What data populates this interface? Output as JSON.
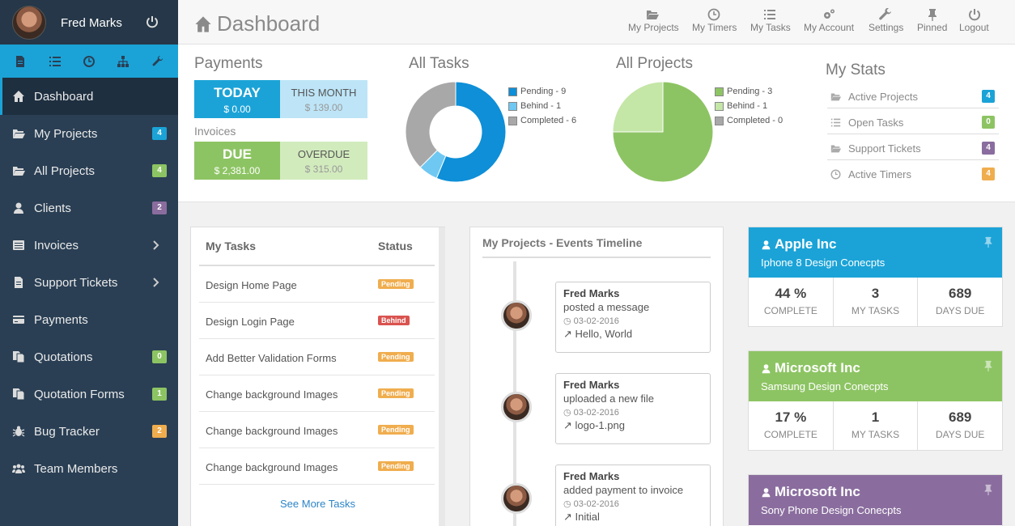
{
  "user": {
    "name": "Fred Marks"
  },
  "sidebar": {
    "items": [
      {
        "label": "Dashboard"
      },
      {
        "label": "My Projects",
        "badge": "4"
      },
      {
        "label": "All Projects",
        "badge": "4"
      },
      {
        "label": "Clients",
        "badge": "2"
      },
      {
        "label": "Invoices"
      },
      {
        "label": "Support Tickets"
      },
      {
        "label": "Payments"
      },
      {
        "label": "Quotations",
        "badge": "0"
      },
      {
        "label": "Quotation Forms",
        "badge": "1"
      },
      {
        "label": "Bug Tracker",
        "badge": "2"
      },
      {
        "label": "Team Members"
      }
    ]
  },
  "header": {
    "title": "Dashboard",
    "nav": [
      "My Projects",
      "My Timers",
      "My Tasks",
      "My Account",
      "Settings",
      "Pinned",
      "Logout"
    ]
  },
  "payments": {
    "title": "Payments",
    "today_label": "TODAY",
    "today_value": "$ 0.00",
    "month_label": "THIS MONTH",
    "month_value": "$ 139.00",
    "invoices_title": "Invoices",
    "due_label": "DUE",
    "due_value": "$ 2,381.00",
    "overdue_label": "OVERDUE",
    "overdue_value": "$ 315.00"
  },
  "all_tasks": {
    "title": "All Tasks",
    "legend": [
      "Pending - 9",
      "Behind - 1",
      "Completed - 6"
    ]
  },
  "all_projects": {
    "title": "All Projects",
    "legend": [
      "Pending - 3",
      "Behind - 1",
      "Completed - 0"
    ]
  },
  "chart_data": [
    {
      "type": "pie",
      "labels": [
        "Pending",
        "Behind",
        "Completed"
      ],
      "values": [
        9,
        1,
        6
      ],
      "colors": [
        "#0e8fd7",
        "#6fc8f2",
        "#a8a8a8"
      ],
      "donut": true
    },
    {
      "type": "pie",
      "labels": [
        "Pending",
        "Behind",
        "Completed"
      ],
      "values": [
        3,
        1,
        0
      ],
      "colors": [
        "#8dc463",
        "#c4e6a7",
        "#a8a8a8"
      ],
      "donut": false
    }
  ],
  "my_stats": {
    "title": "My Stats",
    "items": [
      {
        "label": "Active Projects",
        "badge": "4"
      },
      {
        "label": "Open Tasks",
        "badge": "0"
      },
      {
        "label": "Support Tickets",
        "badge": "4"
      },
      {
        "label": "Active Timers",
        "badge": "4"
      }
    ]
  },
  "tasks": {
    "title": "My Tasks",
    "status_col": "Status",
    "rows": [
      {
        "name": "Design Home Page",
        "status": "Pending"
      },
      {
        "name": "Design Login Page",
        "status": "Behind"
      },
      {
        "name": "Add Better Validation Forms",
        "status": "Pending"
      },
      {
        "name": "Change background Images",
        "status": "Pending"
      },
      {
        "name": "Change background Images",
        "status": "Pending"
      },
      {
        "name": "Change background Images",
        "status": "Pending"
      }
    ],
    "see_more": "See More Tasks"
  },
  "timeline": {
    "title": "My Projects - Events Timeline",
    "events": [
      {
        "user": "Fred Marks",
        "action": "posted a message",
        "date": "03-02-2016",
        "link": "Hello, World"
      },
      {
        "user": "Fred Marks",
        "action": "uploaded a new file",
        "date": "03-02-2016",
        "link": "logo-1.png"
      },
      {
        "user": "Fred Marks",
        "action": "added payment to invoice",
        "date": "03-02-2016",
        "link": "Initial"
      }
    ]
  },
  "projects": [
    {
      "client": "Apple Inc",
      "name": "Iphone 8 Design Conecpts",
      "complete": "44 %",
      "complete_label": "COMPLETE",
      "tasks": "3",
      "tasks_label": "MY TASKS",
      "days": "689",
      "days_label": "DAYS DUE",
      "color": "#1ba3d7"
    },
    {
      "client": "Microsoft Inc",
      "name": "Samsung Design Conecpts",
      "complete": "17 %",
      "complete_label": "COMPLETE",
      "tasks": "1",
      "tasks_label": "MY TASKS",
      "days": "689",
      "days_label": "DAYS DUE",
      "color": "#8dc463"
    },
    {
      "client": "Microsoft Inc",
      "name": "Sony Phone Design Conecpts",
      "color": "#8a6d9e"
    }
  ],
  "colors": {
    "sidebar": "#2a3f54",
    "accent": "#1ba3d7",
    "green": "#8dc463",
    "purple": "#8a6d9e",
    "orange": "#f0ad4e",
    "red": "#d9534f"
  }
}
